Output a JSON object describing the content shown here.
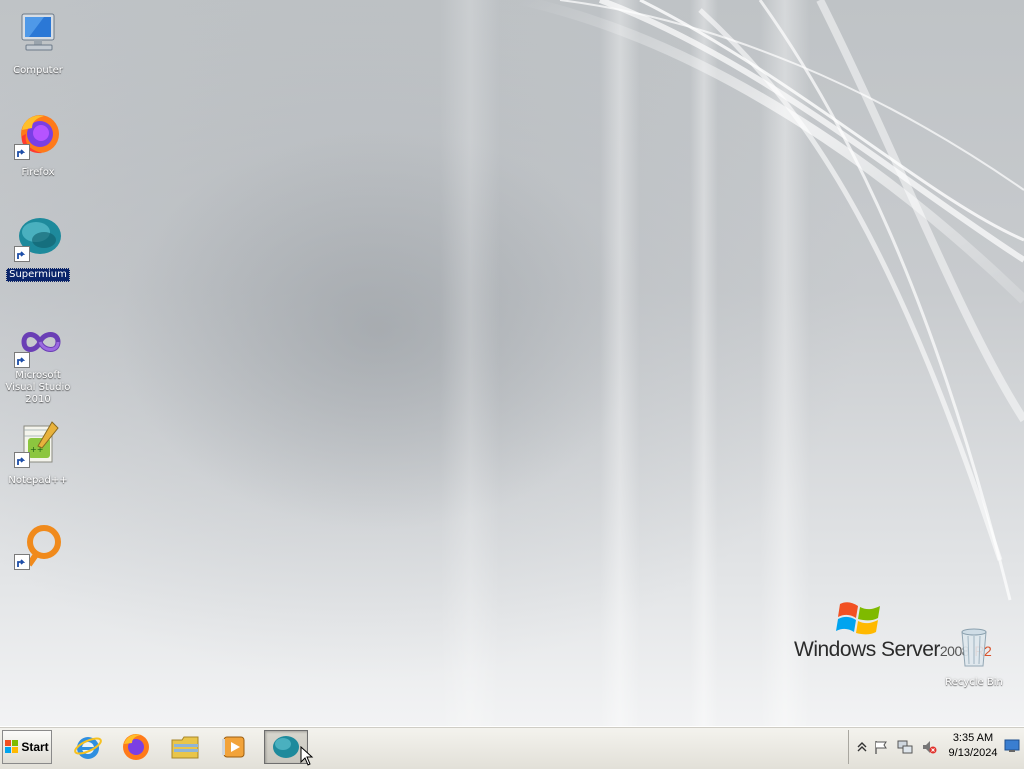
{
  "desktop": {
    "icons": [
      {
        "label": "Computer",
        "icon": "computer-icon"
      },
      {
        "label": "Firefox",
        "icon": "firefox-icon"
      },
      {
        "label": "Supermium",
        "icon": "supermium-icon"
      },
      {
        "label": "Microsoft Visual Studio 2010",
        "icon": "visual-studio-icon"
      },
      {
        "label": "Notepad++",
        "icon": "notepadpp-icon"
      },
      {
        "label": "",
        "icon": "orange-ring-app-icon"
      }
    ],
    "recycle_bin": {
      "label": "Recycle Bin",
      "icon": "recycle-bin-icon"
    },
    "branding": {
      "name": "Windows Server",
      "version": "2008",
      "edition": "R2"
    }
  },
  "taskbar": {
    "start_label": "Start",
    "pinned": [
      {
        "name": "Internet Explorer",
        "icon": "internet-explorer-icon"
      },
      {
        "name": "Firefox",
        "icon": "firefox-icon"
      },
      {
        "name": "Windows Explorer",
        "icon": "folder-icon"
      },
      {
        "name": "Windows Media Player",
        "icon": "media-player-icon"
      },
      {
        "name": "Supermium",
        "icon": "supermium-icon",
        "active": true
      }
    ],
    "tray": {
      "icons": [
        "show-hidden-icons-chevron",
        "action-center-flag-icon",
        "network-icon",
        "volume-muted-icon"
      ],
      "time": "3:35 AM",
      "date": "9/13/2024"
    }
  },
  "colors": {
    "selection": "#0a246a",
    "taskbar": "#e9e7e0",
    "accent_orange": "#f08a1c"
  }
}
